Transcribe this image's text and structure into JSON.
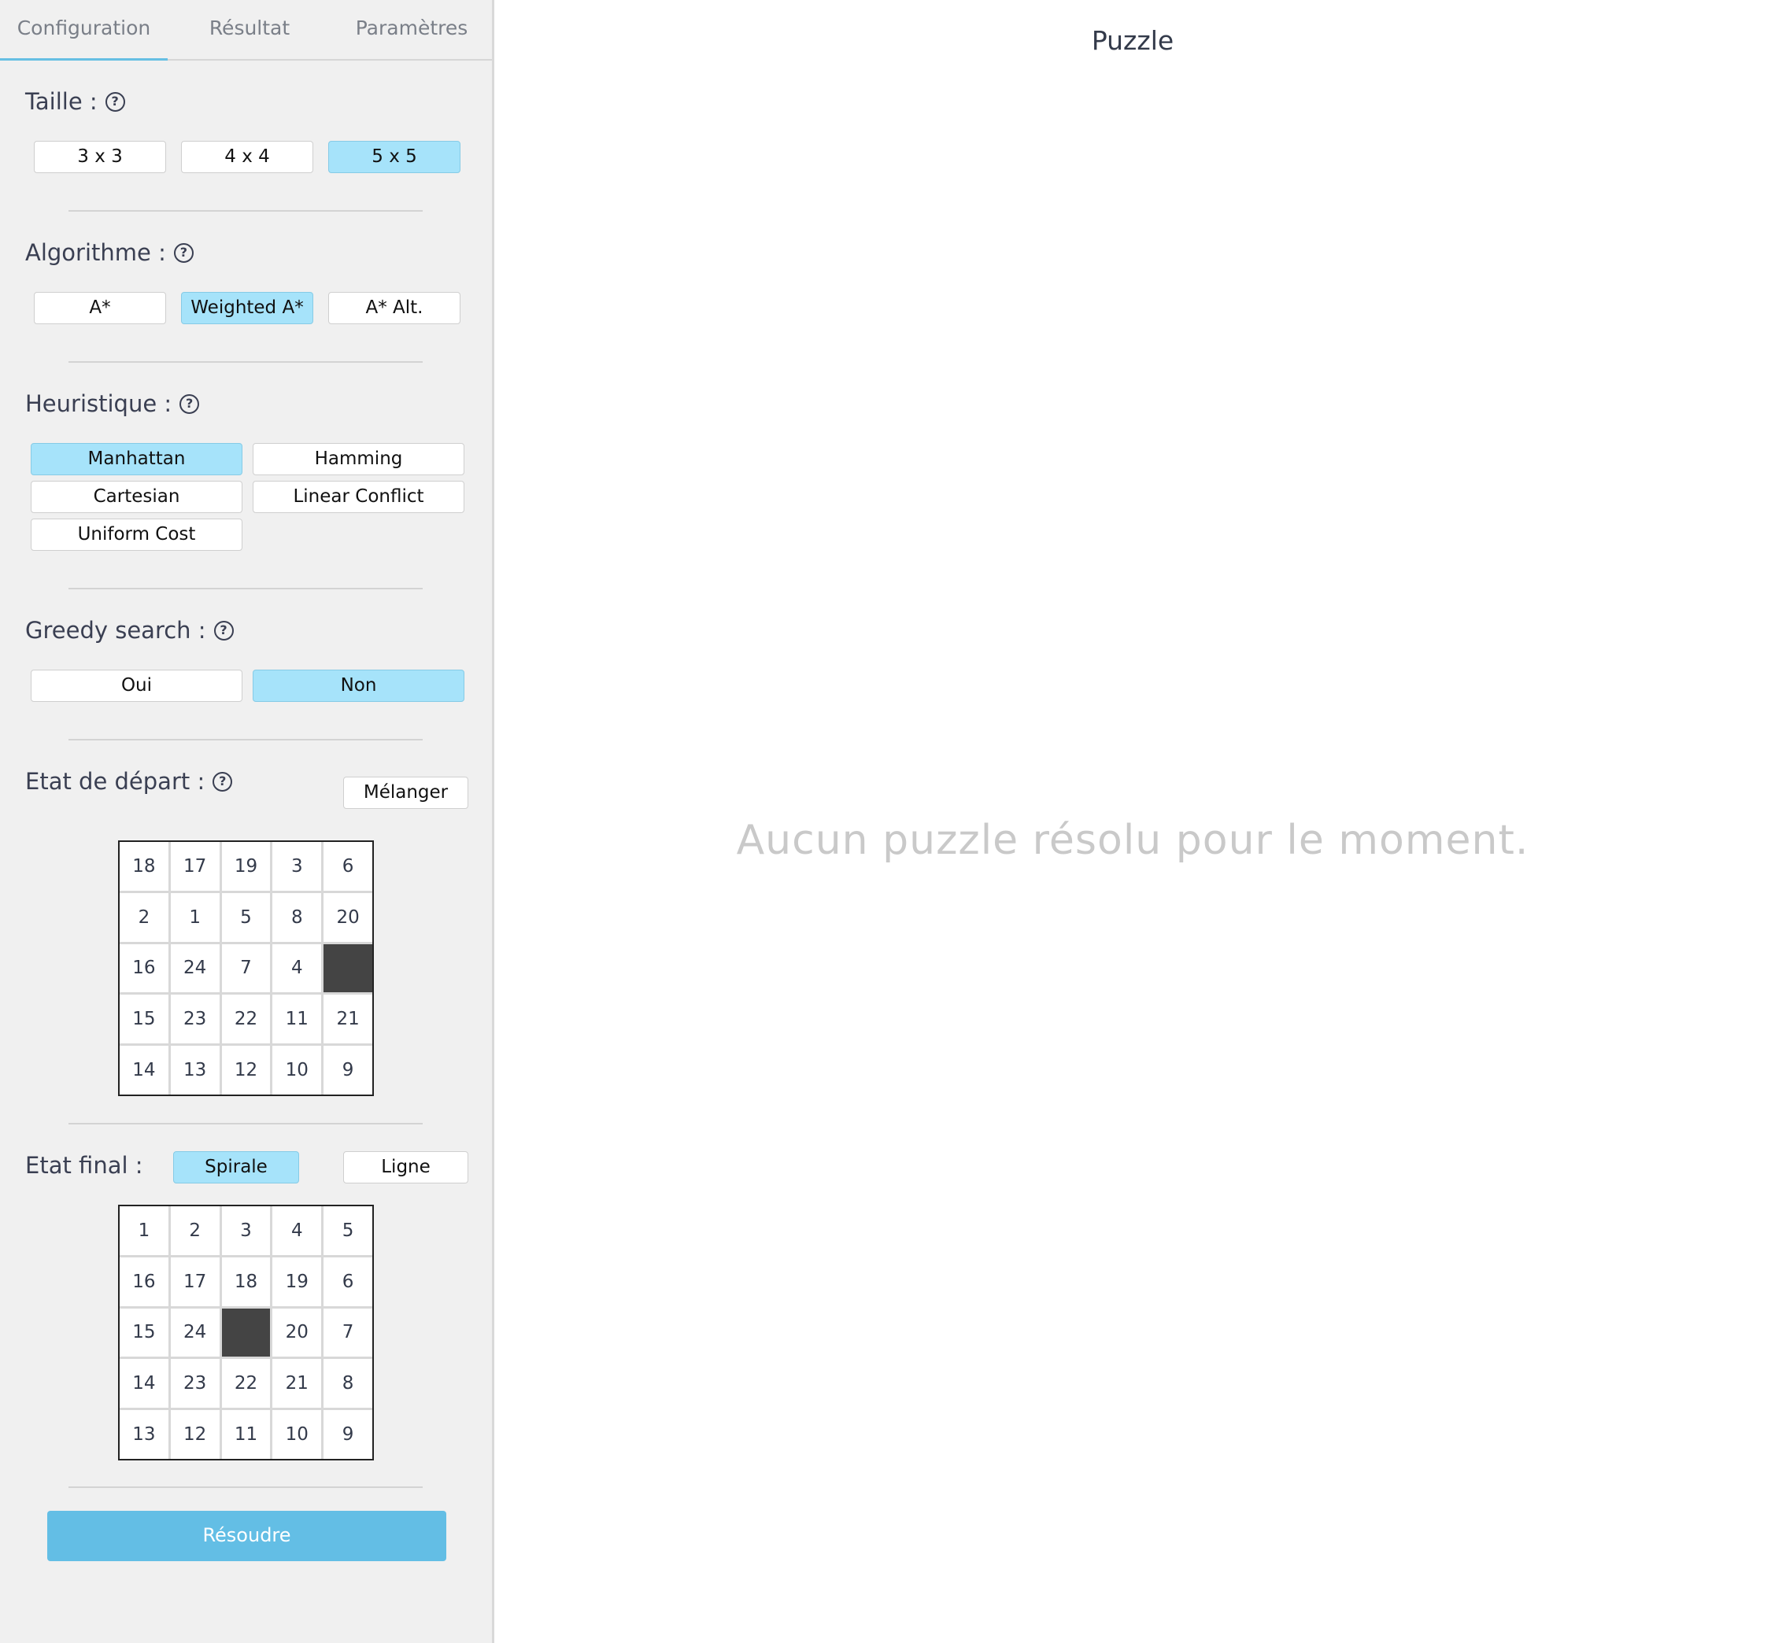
{
  "tabs": [
    "Configuration",
    "Résultat",
    "Paramètres"
  ],
  "size": {
    "title": "Taille :",
    "options": [
      "3 x 3",
      "4 x 4",
      "5 x 5"
    ],
    "selected": "5 x 5"
  },
  "algorithm": {
    "title": "Algorithme :",
    "options": [
      "A*",
      "Weighted A*",
      "A* Alt."
    ],
    "selected": "Weighted A*"
  },
  "heuristic": {
    "title": "Heuristique :",
    "options": [
      "Manhattan",
      "Hamming",
      "Cartesian",
      "Linear Conflict",
      "Uniform Cost"
    ],
    "selected": "Manhattan"
  },
  "greedy": {
    "title": "Greedy search :",
    "options": [
      "Oui",
      "Non"
    ],
    "selected": "Non"
  },
  "start": {
    "title": "Etat de départ :",
    "shuffle_label": "Mélanger",
    "cells": [
      "18",
      "17",
      "19",
      "3",
      "6",
      "2",
      "1",
      "5",
      "8",
      "20",
      "16",
      "24",
      "7",
      "4",
      "",
      "15",
      "23",
      "22",
      "11",
      "21",
      "14",
      "13",
      "12",
      "10",
      "9"
    ]
  },
  "final": {
    "title": "Etat final :",
    "options": [
      "Spirale",
      "Ligne"
    ],
    "selected": "Spirale",
    "cells": [
      "1",
      "2",
      "3",
      "4",
      "5",
      "16",
      "17",
      "18",
      "19",
      "6",
      "15",
      "24",
      "",
      "20",
      "7",
      "14",
      "23",
      "22",
      "21",
      "8",
      "13",
      "12",
      "11",
      "10",
      "9"
    ]
  },
  "solve_label": "Résoudre",
  "main": {
    "title": "Puzzle",
    "empty_message": "Aucun puzzle résolu pour le moment."
  },
  "colors": {
    "selected_button": "#a6e3fa",
    "solve_button": "#63bee5",
    "empty_tile": "#444444",
    "tab_indicator": "#66bfe3"
  }
}
